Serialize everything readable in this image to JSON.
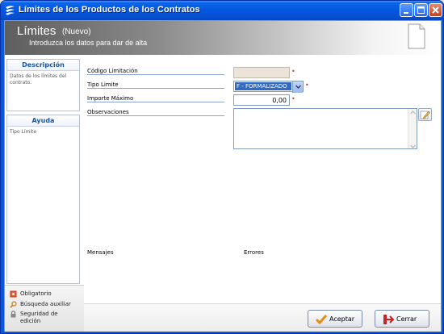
{
  "window": {
    "title": "Límites de los Productos de los Contratos"
  },
  "header": {
    "title": "Límites",
    "status": "(Nuevo)",
    "description": "Introduzca los datos para dar de alta"
  },
  "sidebar": {
    "description_panel": {
      "heading": "Descripción",
      "text": "Datos de los límites del contrato."
    },
    "help_panel": {
      "heading": "Ayuda",
      "text": "Tipo Límite"
    },
    "legend": {
      "required": "Obligatorio",
      "search": "Búsqueda auxiliar",
      "security_line1": "Seguridad de",
      "security_line2": "edición"
    }
  },
  "form": {
    "codigo_limitacion": {
      "label": "Código Limitación",
      "value": ""
    },
    "tipo_limite": {
      "label": "Tipo Limite",
      "value": "F - FORMALIZADO"
    },
    "importe_maximo": {
      "label": "Importe Máximo",
      "value": "0,00"
    },
    "observaciones": {
      "label": "Observaciones",
      "value": ""
    },
    "required_mark": "•"
  },
  "messages": {
    "mensajes_label": "Mensajes",
    "errores_label": "Errores"
  },
  "buttons": {
    "accept": "Aceptar",
    "close": "Cerrar"
  },
  "colors": {
    "titlebar": "#0556de",
    "selection": "#316ac5",
    "required": "#d93030",
    "panel_heading": "#1a56a6"
  }
}
